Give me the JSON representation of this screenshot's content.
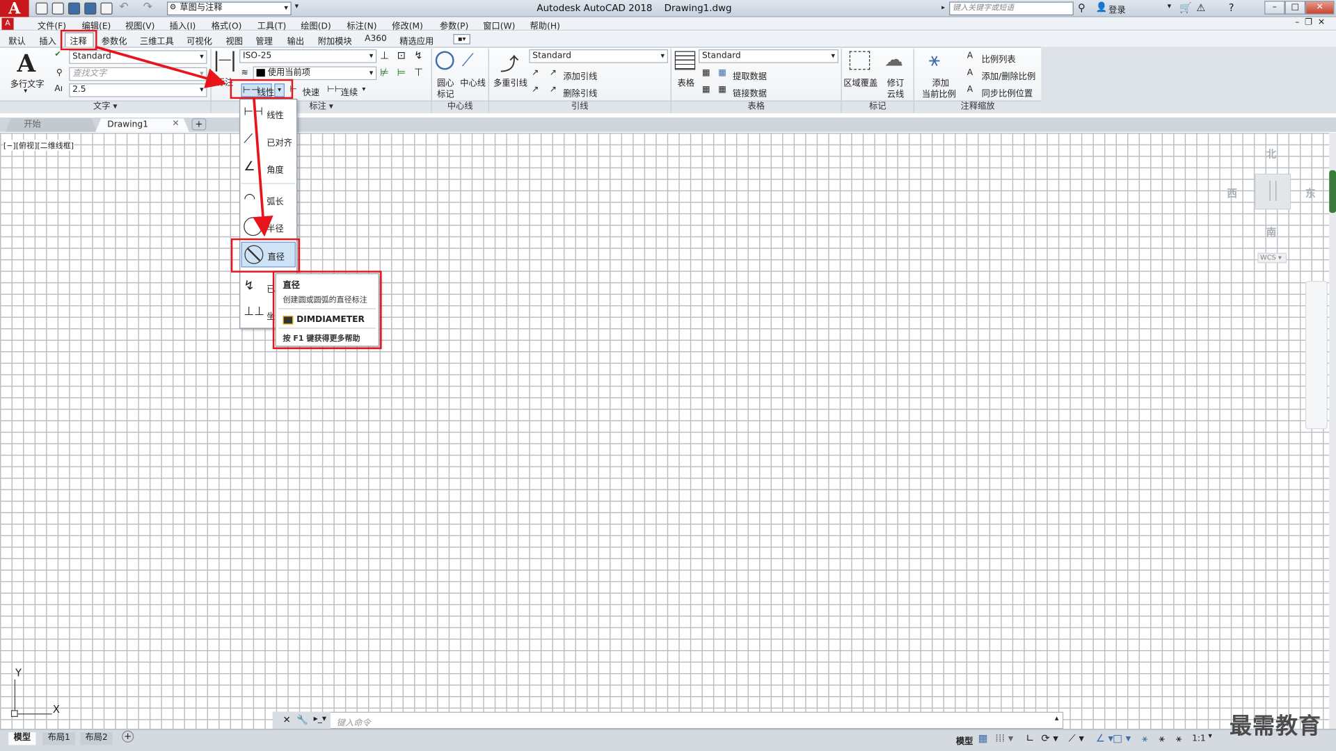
{
  "titlebar": {
    "workspace": "草图与注释",
    "app_title": "Autodesk AutoCAD 2018",
    "file_title": "Drawing1.dwg",
    "search_placeholder": "键入关键字或短语",
    "login": "登录"
  },
  "menubar": [
    "文件(F)",
    "编辑(E)",
    "视图(V)",
    "插入(I)",
    "格式(O)",
    "工具(T)",
    "绘图(D)",
    "标注(N)",
    "修改(M)",
    "参数(P)",
    "窗口(W)",
    "帮助(H)"
  ],
  "ribbon_tabs": [
    "默认",
    "插入",
    "注释",
    "参数化",
    "三维工具",
    "可视化",
    "视图",
    "管理",
    "输出",
    "附加模块",
    "A360",
    "精选应用"
  ],
  "ribbon": {
    "text_panel": {
      "mtext_label": "多行文字",
      "style_value": "Standard",
      "find_placeholder": "查找文字",
      "height_value": "2.5",
      "title": "文字"
    },
    "dim_panel": {
      "dimstyle_value": "ISO-25",
      "layer_value": "使用当前项",
      "linear_label": "线性",
      "quick_label": "快速",
      "continue_label": "连续",
      "title": "标注",
      "dim_partial_label": "标注"
    },
    "centerline_panel": {
      "center_mark_label_1": "圆心",
      "center_mark_label_2": "标记",
      "centerline_label": "中心线",
      "title": "中心线"
    },
    "leader_panel": {
      "mleader_label": "多重引线",
      "style_value": "Standard",
      "add_leader": "添加引线",
      "remove_leader": "删除引线",
      "title": "引线"
    },
    "table_panel": {
      "table_label": "表格",
      "style_value": "Standard",
      "extract_data": "提取数据",
      "link_data": "链接数据",
      "title": "表格"
    },
    "markup_panel": {
      "wipeout_label": "区域覆盖",
      "revcloud_label_1": "修订",
      "revcloud_label_2": "云线",
      "title": "标记"
    },
    "scale_panel": {
      "add_label_1": "添加",
      "add_label_2": "当前比例",
      "scale_list": "比例列表",
      "add_remove_scale": "添加/删除比例",
      "sync_scale": "同步比例位置",
      "title": "注释缩放"
    }
  },
  "filetabs": {
    "start": "开始",
    "drawing": "Drawing1"
  },
  "viewport_label": "[−][俯视][二维线框]",
  "viewcube": {
    "north": "北",
    "south": "南",
    "east": "东",
    "west": "西",
    "wcs": "WCS"
  },
  "ucs": {
    "x": "X",
    "y": "Y"
  },
  "dropdown": {
    "items": [
      "线性",
      "已对齐",
      "角度",
      "弧长",
      "半径",
      "直径",
      "已折弯",
      "坐标"
    ]
  },
  "tooltip": {
    "title": "直径",
    "description": "创建圆或圆弧的直径标注",
    "command": "DIMDIAMETER",
    "help": "按 F1 键获得更多帮助"
  },
  "commandline": {
    "placeholder": "键入命令"
  },
  "statusbar": {
    "layout_tabs": [
      "模型",
      "布局1",
      "布局2"
    ],
    "model_label": "模型",
    "scale": "1:1"
  },
  "watermark": "最需教育",
  "colors": {
    "accent": "#e8141c",
    "logo": "#c8181e"
  }
}
